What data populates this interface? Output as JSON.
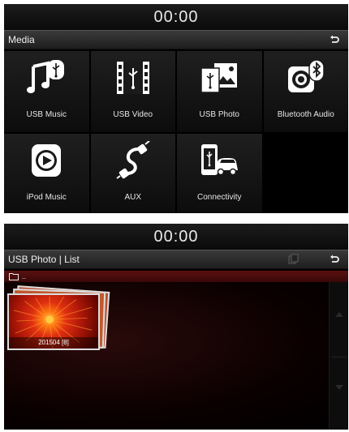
{
  "media_screen": {
    "clock": "00:00",
    "title": "Media",
    "back_icon": "back-arrow-icon",
    "tiles": [
      {
        "label": "USB Music",
        "icon": "usb-music-icon"
      },
      {
        "label": "USB Video",
        "icon": "usb-video-icon"
      },
      {
        "label": "USB Photo",
        "icon": "usb-photo-icon"
      },
      {
        "label": "Bluetooth Audio",
        "icon": "bluetooth-audio-icon"
      },
      {
        "label": "iPod Music",
        "icon": "ipod-icon"
      },
      {
        "label": "AUX",
        "icon": "aux-cable-icon"
      },
      {
        "label": "Connectivity",
        "icon": "connectivity-icon"
      }
    ]
  },
  "photo_screen": {
    "clock": "00:00",
    "title": "USB Photo | List",
    "path": "..",
    "folders": [
      {
        "name": "201504 [8]"
      }
    ]
  },
  "colors": {
    "background": "#000000",
    "text": "#e6e6e6",
    "path_bar": "#4a0c0c"
  }
}
